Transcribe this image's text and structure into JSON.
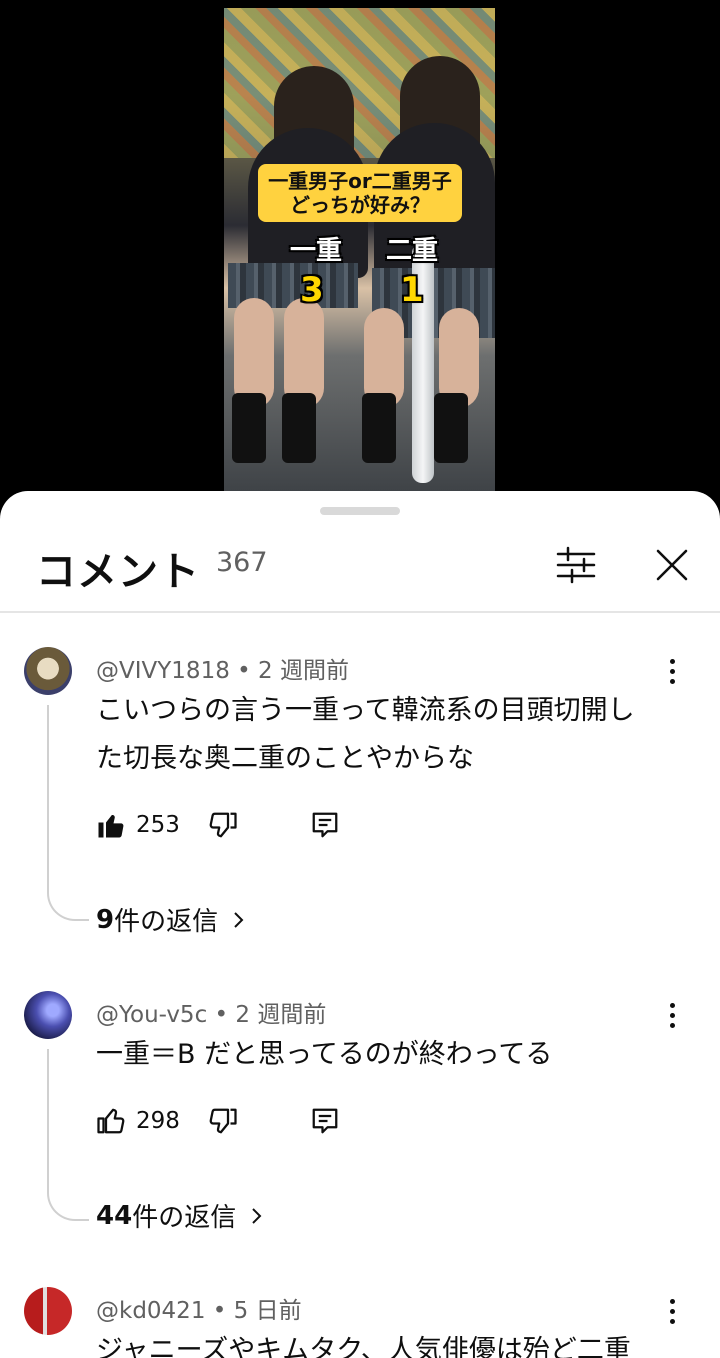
{
  "video": {
    "banner_line1": "一重男子or二重男子",
    "banner_line2": "どっちが好み？",
    "left_label": "一重",
    "left_count": "3",
    "right_label": "二重",
    "right_count": "1"
  },
  "comments_header": {
    "title": "コメント",
    "count": "367"
  },
  "comments": [
    {
      "author": "@VIVY1818",
      "time": "2 週間前",
      "text_line1": "こいつらの言う一重って韓流系の目頭切開し",
      "text_line2": "た切長な奥二重のことやからな",
      "likes": "253",
      "liked": true,
      "replies_count": "9",
      "replies_suffix": " 件の返信"
    },
    {
      "author": "@You-v5c",
      "time": "2 週間前",
      "text_line1": "一重＝B だと思ってるのが終わってる",
      "likes": "298",
      "liked": false,
      "replies_count": "44",
      "replies_suffix": " 件の返信"
    },
    {
      "author": "@kd0421",
      "time": "5 日前",
      "text_line1": "ジャニーズやキムタク、人気俳優は殆ど二重"
    }
  ],
  "separator": " • "
}
